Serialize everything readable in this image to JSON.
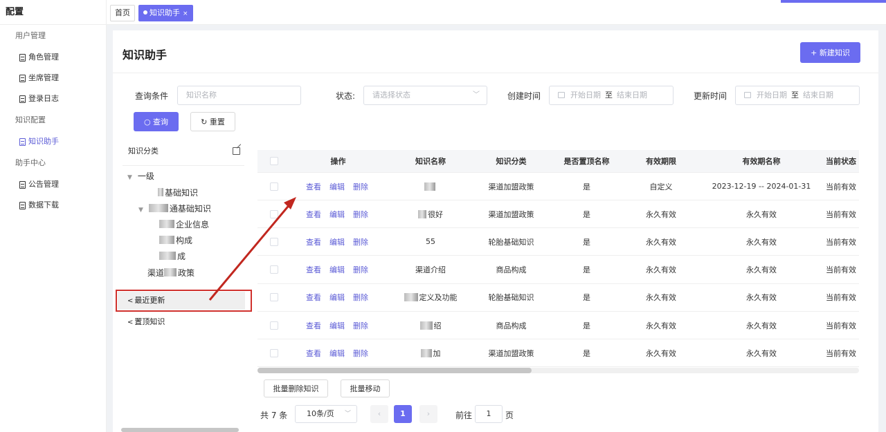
{
  "sidebar": {
    "title": "配置",
    "groups": [
      {
        "label": "用户管理",
        "items": [
          "角色管理",
          "坐席管理",
          "登录日志"
        ]
      },
      {
        "label": "知识配置",
        "items": [
          "知识助手"
        ]
      },
      {
        "label": "助手中心",
        "items": [
          "公告管理",
          "数据下载"
        ]
      }
    ],
    "active": "知识助手"
  },
  "tabs": {
    "home": "首页",
    "active": "知识助手",
    "close": "×"
  },
  "page": {
    "title": "知识助手",
    "new_button": "+ 新建知识"
  },
  "filters": {
    "query_label": "查询条件",
    "name_placeholder": "知识名称",
    "status_label": "状态:",
    "status_placeholder": "请选择状态",
    "created_label": "创建时间",
    "updated_label": "更新时间",
    "start_placeholder": "开始日期",
    "end_placeholder": "结束日期",
    "to": "至",
    "search_button": "查询",
    "reset_button": "重置"
  },
  "tree": {
    "title": "知识分类",
    "root": "一级",
    "nodes": [
      "基础知识",
      "通基础知识",
      "企业信息",
      "构成",
      "成",
      "政策"
    ],
    "node_prefix": "渠道",
    "recent": "最近更新",
    "pinned": "置顶知识"
  },
  "table": {
    "headers": [
      "操作",
      "知识名称",
      "知识分类",
      "是否置顶名称",
      "有效期限",
      "有效期名称",
      "当前状态"
    ],
    "actions": [
      "查看",
      "编辑",
      "删除"
    ],
    "rows": [
      {
        "name": "",
        "category": "渠道加盟政策",
        "pinned": "是",
        "period": "自定义",
        "period_name": "2023-12-19 -- 2024-01-31",
        "status": "当前有效"
      },
      {
        "name": "很好",
        "category": "渠道加盟政策",
        "pinned": "是",
        "period": "永久有效",
        "period_name": "永久有效",
        "status": "当前有效"
      },
      {
        "name": "55",
        "category": "轮胎基础知识",
        "pinned": "是",
        "period": "永久有效",
        "period_name": "永久有效",
        "status": "当前有效"
      },
      {
        "name": "渠道介绍",
        "category": "商品构成",
        "pinned": "是",
        "period": "永久有效",
        "period_name": "永久有效",
        "status": "当前有效"
      },
      {
        "name": "定义及功能",
        "category": "轮胎基础知识",
        "pinned": "是",
        "period": "永久有效",
        "period_name": "永久有效",
        "status": "当前有效"
      },
      {
        "name": "绍",
        "category": "商品构成",
        "pinned": "是",
        "period": "永久有效",
        "period_name": "永久有效",
        "status": "当前有效"
      },
      {
        "name": "加",
        "category": "渠道加盟政策",
        "pinned": "是",
        "period": "永久有效",
        "period_name": "永久有效",
        "status": "当前有效"
      }
    ]
  },
  "bulk": {
    "delete": "批量删除知识",
    "move": "批量移动"
  },
  "pagination": {
    "total": "共 7 条",
    "page_size": "10条/页",
    "current": "1",
    "goto_label": "前往",
    "goto_value": "1",
    "page_suffix": "页",
    "prev": "‹",
    "next": "›"
  },
  "colors": {
    "accent": "#6b6cf0",
    "highlight_box": "#d0312d",
    "arrow": "#c1271f"
  }
}
